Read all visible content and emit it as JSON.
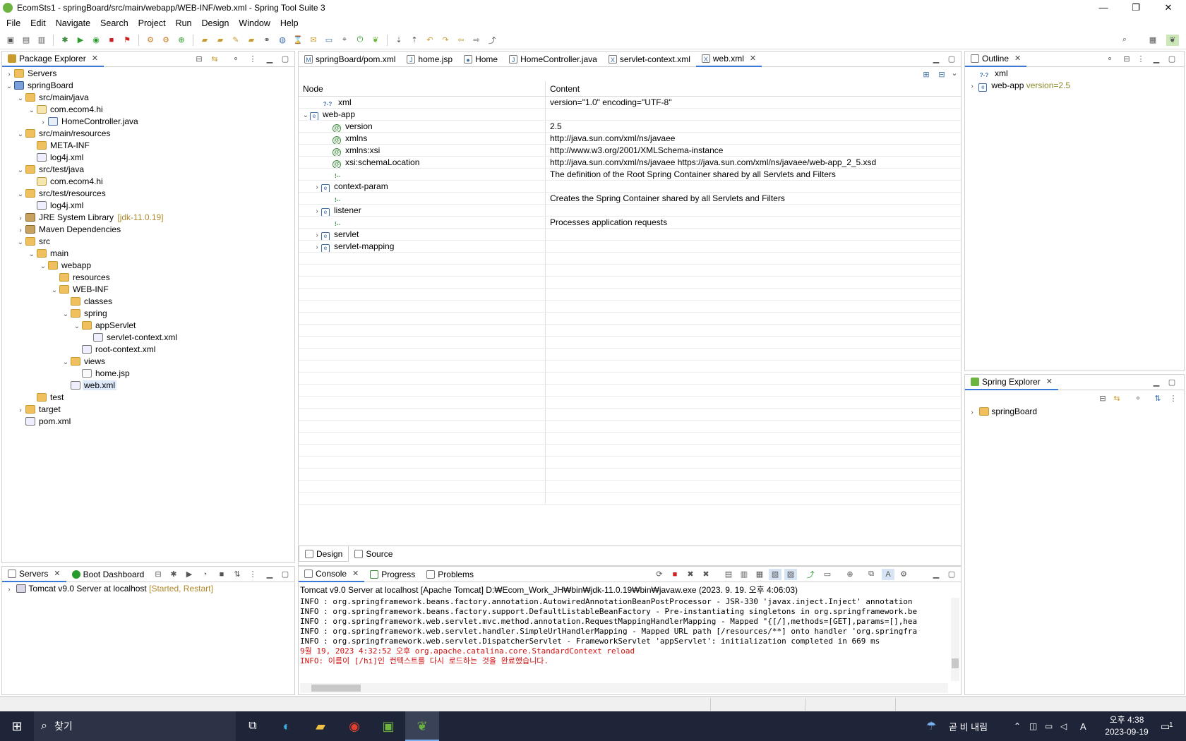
{
  "window": {
    "title": "EcomSts1 - springBoard/src/main/webapp/WEB-INF/web.xml - Spring Tool Suite 3",
    "minimize": "—",
    "restore": "❐",
    "close": "✕"
  },
  "menu": [
    "File",
    "Edit",
    "Navigate",
    "Search",
    "Project",
    "Run",
    "Design",
    "Window",
    "Help"
  ],
  "package_explorer": {
    "tab": "Package Explorer",
    "tree": [
      {
        "label": "Servers",
        "depth": 0,
        "twisty": "›",
        "icon": "folder"
      },
      {
        "label": "springBoard",
        "depth": 0,
        "twisty": "⌄",
        "icon": "proj"
      },
      {
        "label": "src/main/java",
        "depth": 1,
        "twisty": "⌄",
        "icon": "pkgfolder"
      },
      {
        "label": "com.ecom4.hi",
        "depth": 2,
        "twisty": "⌄",
        "icon": "pkg"
      },
      {
        "label": "HomeController.java",
        "depth": 3,
        "twisty": "›",
        "icon": "java"
      },
      {
        "label": "src/main/resources",
        "depth": 1,
        "twisty": "⌄",
        "icon": "pkgfolder"
      },
      {
        "label": "META-INF",
        "depth": 2,
        "twisty": "",
        "icon": "folder"
      },
      {
        "label": "log4j.xml",
        "depth": 2,
        "twisty": "",
        "icon": "xml"
      },
      {
        "label": "src/test/java",
        "depth": 1,
        "twisty": "⌄",
        "icon": "pkgfolder"
      },
      {
        "label": "com.ecom4.hi",
        "depth": 2,
        "twisty": "",
        "icon": "pkg"
      },
      {
        "label": "src/test/resources",
        "depth": 1,
        "twisty": "⌄",
        "icon": "pkgfolder"
      },
      {
        "label": "log4j.xml",
        "depth": 2,
        "twisty": "",
        "icon": "xml"
      },
      {
        "label": "JRE System Library",
        "depth": 1,
        "twisty": "›",
        "icon": "lib",
        "decor": "[jdk-11.0.19]"
      },
      {
        "label": "Maven Dependencies",
        "depth": 1,
        "twisty": "›",
        "icon": "lib"
      },
      {
        "label": "src",
        "depth": 1,
        "twisty": "⌄",
        "icon": "folder"
      },
      {
        "label": "main",
        "depth": 2,
        "twisty": "⌄",
        "icon": "folder"
      },
      {
        "label": "webapp",
        "depth": 3,
        "twisty": "⌄",
        "icon": "folder"
      },
      {
        "label": "resources",
        "depth": 4,
        "twisty": "",
        "icon": "folder"
      },
      {
        "label": "WEB-INF",
        "depth": 4,
        "twisty": "⌄",
        "icon": "folder"
      },
      {
        "label": "classes",
        "depth": 5,
        "twisty": "",
        "icon": "folder"
      },
      {
        "label": "spring",
        "depth": 5,
        "twisty": "⌄",
        "icon": "folder"
      },
      {
        "label": "appServlet",
        "depth": 6,
        "twisty": "⌄",
        "icon": "folder"
      },
      {
        "label": "servlet-context.xml",
        "depth": 7,
        "twisty": "",
        "icon": "xml"
      },
      {
        "label": "root-context.xml",
        "depth": 6,
        "twisty": "",
        "icon": "xml"
      },
      {
        "label": "views",
        "depth": 5,
        "twisty": "⌄",
        "icon": "folder"
      },
      {
        "label": "home.jsp",
        "depth": 6,
        "twisty": "",
        "icon": "jsp"
      },
      {
        "label": "web.xml",
        "depth": 5,
        "twisty": "",
        "icon": "xml",
        "selected": true
      },
      {
        "label": "test",
        "depth": 2,
        "twisty": "",
        "icon": "folder"
      },
      {
        "label": "target",
        "depth": 1,
        "twisty": "›",
        "icon": "folder"
      },
      {
        "label": "pom.xml",
        "depth": 1,
        "twisty": "",
        "icon": "xml"
      }
    ]
  },
  "editor": {
    "tabs": [
      {
        "label": "springBoard/pom.xml",
        "icon": "M"
      },
      {
        "label": "home.jsp",
        "icon": "J"
      },
      {
        "label": "Home",
        "icon": "●"
      },
      {
        "label": "HomeController.java",
        "icon": "J"
      },
      {
        "label": "servlet-context.xml",
        "icon": "X"
      },
      {
        "label": "web.xml",
        "icon": "X",
        "active": true
      }
    ],
    "columns": {
      "node": "Node",
      "content": "Content"
    },
    "rows": [
      {
        "type": "pi",
        "node": "xml",
        "content": "version=\"1.0\" encoding=\"UTF-8\"",
        "indent": 1,
        "twisty": ""
      },
      {
        "type": "e",
        "node": "web-app",
        "content": "",
        "indent": 0,
        "twisty": "⌄"
      },
      {
        "type": "a",
        "node": "version",
        "content": "2.5",
        "indent": 2,
        "twisty": ""
      },
      {
        "type": "a",
        "node": "xmlns",
        "content": "http://java.sun.com/xml/ns/javaee",
        "indent": 2,
        "twisty": ""
      },
      {
        "type": "a",
        "node": "xmlns:xsi",
        "content": "http://www.w3.org/2001/XMLSchema-instance",
        "indent": 2,
        "twisty": ""
      },
      {
        "type": "a",
        "node": "xsi:schemaLocation",
        "content": "http://java.sun.com/xml/ns/javaee https://java.sun.com/xml/ns/javaee/web-app_2_5.xsd",
        "indent": 2,
        "twisty": ""
      },
      {
        "type": "c",
        "node": "",
        "content": " The definition of the Root Spring Container shared by all Servlets and Filters",
        "indent": 2,
        "twisty": ""
      },
      {
        "type": "e",
        "node": "context-param",
        "content": "",
        "indent": 1,
        "twisty": "›"
      },
      {
        "type": "c",
        "node": "",
        "content": " Creates the Spring Container shared by all Servlets and Filters",
        "indent": 2,
        "twisty": ""
      },
      {
        "type": "e",
        "node": "listener",
        "content": "",
        "indent": 1,
        "twisty": "›"
      },
      {
        "type": "c",
        "node": "",
        "content": " Processes application requests",
        "indent": 2,
        "twisty": ""
      },
      {
        "type": "e",
        "node": "servlet",
        "content": "",
        "indent": 1,
        "twisty": "›"
      },
      {
        "type": "e",
        "node": "servlet-mapping",
        "content": "",
        "indent": 1,
        "twisty": "›"
      }
    ],
    "bottom_tabs": [
      {
        "label": "Design",
        "active": true
      },
      {
        "label": "Source"
      }
    ]
  },
  "outline": {
    "tab": "Outline",
    "rows": [
      {
        "label": "xml",
        "twisty": "",
        "icon": "?-?"
      },
      {
        "label": "web-app",
        "twisty": "›",
        "icon": "e",
        "decor": "version=2.5"
      }
    ]
  },
  "spring_explorer": {
    "tab": "Spring Explorer",
    "rows": [
      {
        "label": "springBoard",
        "twisty": "›"
      }
    ]
  },
  "servers": {
    "tabs": [
      "Servers",
      "Boot Dashboard"
    ],
    "rows": [
      {
        "label": "Tomcat v9.0 Server at localhost",
        "decor": "[Started, Restart]"
      }
    ]
  },
  "console": {
    "tabs": [
      "Console",
      "Progress",
      "Problems"
    ],
    "header": "Tomcat v9.0 Server at localhost [Apache Tomcat] D:₩Ecom_Work_JH₩bin₩jdk-11.0.19₩bin₩javaw.exe  (2023. 9. 19. 오후 4:06:03)",
    "lines": [
      {
        "text": "INFO : org.springframework.beans.factory.annotation.AutowiredAnnotationBeanPostProcessor - JSR-330 'javax.inject.Inject' annotation",
        "red": false
      },
      {
        "text": "INFO : org.springframework.beans.factory.support.DefaultListableBeanFactory - Pre-instantiating singletons in org.springframework.be",
        "red": false
      },
      {
        "text": "INFO : org.springframework.web.servlet.mvc.method.annotation.RequestMappingHandlerMapping - Mapped \"{[/],methods=[GET],params=[],hea",
        "red": false
      },
      {
        "text": "INFO : org.springframework.web.servlet.handler.SimpleUrlHandlerMapping - Mapped URL path [/resources/**] onto handler 'org.springfra",
        "red": false
      },
      {
        "text": "INFO : org.springframework.web.servlet.DispatcherServlet - FrameworkServlet 'appServlet': initialization completed in 669 ms",
        "red": false
      },
      {
        "text": "9월 19, 2023 4:32:52 오후 org.apache.catalina.core.StandardContext reload",
        "red": true
      },
      {
        "text": "INFO: 이름이 [/hi]인 컨텍스트를 다시 로드하는 것을 완료했습니다.",
        "red": true
      }
    ]
  },
  "taskbar": {
    "search": "찾기",
    "weather": "곧 비 내림",
    "time": "오후 4:38",
    "date": "2023-09-19",
    "notifications": "1",
    "ime": "A"
  }
}
